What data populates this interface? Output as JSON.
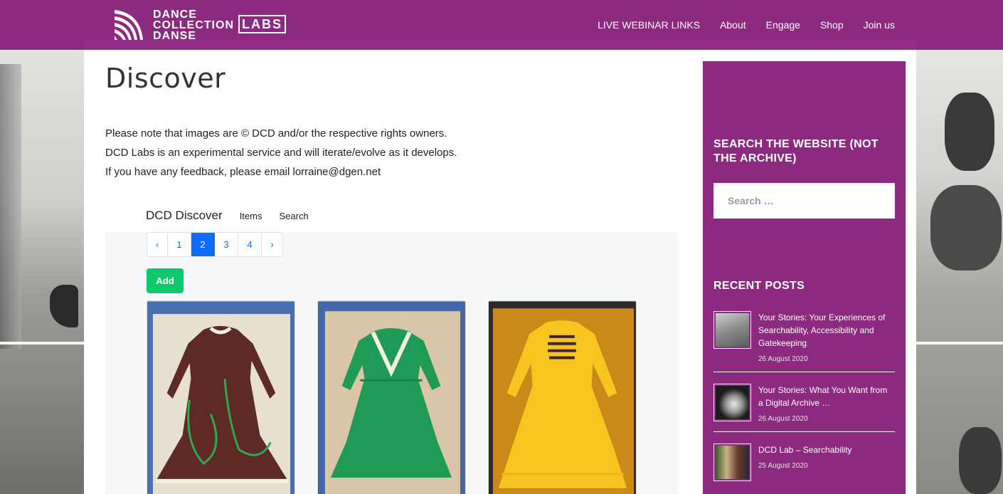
{
  "header": {
    "logo_text_lines": [
      "DANCE",
      "COLLECTION",
      "DANSE"
    ],
    "logo_badge": "LABS",
    "nav": [
      "LIVE WEBINAR LINKS",
      "About",
      "Engage",
      "Shop",
      "Join us"
    ]
  },
  "main": {
    "title": "Discover",
    "notes": [
      "Please note that images are © DCD and/or the respective rights owners.",
      "DCD Labs is an experimental service and will iterate/evolve as it develops.",
      "If you have any feedback, please email lorraine@dgen.net"
    ],
    "discover_nav": {
      "brand": "DCD Discover",
      "links": [
        "Items",
        "Search"
      ]
    },
    "pagination": {
      "prev": "‹",
      "pages": [
        "1",
        "2",
        "3",
        "4"
      ],
      "active": "2",
      "next": "›"
    },
    "add_button": "Add",
    "cards": [
      {
        "icon": "brown-dress-photo",
        "color": "#6b2f28"
      },
      {
        "icon": "green-dress-photo",
        "color": "#1fa95a"
      },
      {
        "icon": "yellow-dress-photo",
        "color": "#f4c21e"
      }
    ]
  },
  "sidebar": {
    "search_heading": "SEARCH THE WEBSITE (NOT THE ARCHIVE)",
    "search_placeholder": "Search …",
    "recent_heading": "RECENT POSTS",
    "posts": [
      {
        "title": "Your Stories: Your Experiences of Searchability, Accessibility and Gatekeeping",
        "date": "26 August 2020"
      },
      {
        "title": "Your Stories: What You Want from a Digital Archive …",
        "date": "26 August 2020"
      },
      {
        "title": "DCD Lab – Searchability",
        "date": "25 August 2020"
      }
    ]
  },
  "colors": {
    "brand_purple": "#8b2a7e",
    "active_page": "#0d6efd",
    "add_green": "#10c96f"
  }
}
